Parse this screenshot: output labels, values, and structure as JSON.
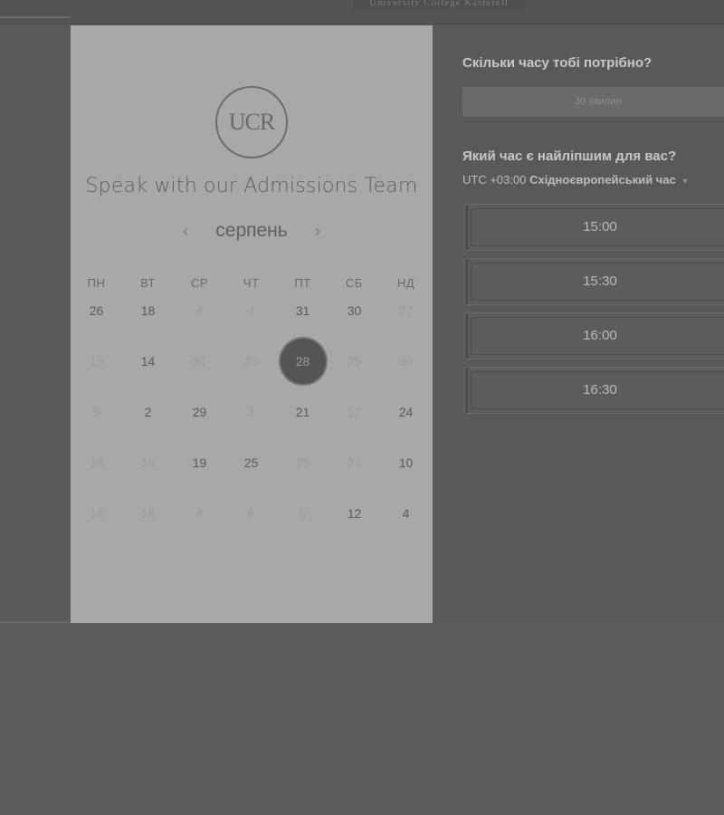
{
  "header": {
    "brand": "University College Kasterell"
  },
  "calendar": {
    "logo_text": "UCR",
    "title": "Speak with our Admissions Team",
    "month": "серпень",
    "prev_icon": "chevron-left-icon",
    "next_icon": "chevron-right-icon",
    "weekdays": [
      "ПН",
      "ВТ",
      "СР",
      "ЧТ",
      "ПТ",
      "СБ",
      "НД"
    ],
    "weeks": [
      [
        {
          "d": "26",
          "s": "active"
        },
        {
          "d": "18",
          "s": "active"
        },
        {
          "d": "4",
          "s": "inactive"
        },
        {
          "d": "4",
          "s": "inactive"
        },
        {
          "d": "31",
          "s": "active"
        },
        {
          "d": "30",
          "s": "active"
        },
        {
          "d": "27",
          "s": "inactive"
        }
      ],
      [
        {
          "d": "19",
          "s": "inactive"
        },
        {
          "d": "14",
          "s": "active"
        },
        {
          "d": "31",
          "s": "inactive"
        },
        {
          "d": "23",
          "s": "inactive"
        },
        {
          "d": "28",
          "s": "selected"
        },
        {
          "d": "29",
          "s": "inactive"
        },
        {
          "d": "30",
          "s": "inactive"
        }
      ],
      [
        {
          "d": "5",
          "s": "inactive"
        },
        {
          "d": "2",
          "s": "active"
        },
        {
          "d": "29",
          "s": "active"
        },
        {
          "d": "3",
          "s": "inactive"
        },
        {
          "d": "21",
          "s": "active"
        },
        {
          "d": "17",
          "s": "inactive"
        },
        {
          "d": "24",
          "s": "active"
        }
      ],
      [
        {
          "d": "18",
          "s": "inactive"
        },
        {
          "d": "19",
          "s": "inactive"
        },
        {
          "d": "19",
          "s": "active"
        },
        {
          "d": "25",
          "s": "active"
        },
        {
          "d": "25",
          "s": "inactive"
        },
        {
          "d": "21",
          "s": "inactive"
        },
        {
          "d": "10",
          "s": "active"
        }
      ],
      [
        {
          "d": "14",
          "s": "inactive"
        },
        {
          "d": "18",
          "s": "inactive"
        },
        {
          "d": "4",
          "s": "inactive"
        },
        {
          "d": "6",
          "s": "inactive"
        },
        {
          "d": "5",
          "s": "inactive"
        },
        {
          "d": "12",
          "s": "active"
        },
        {
          "d": "4",
          "s": "active"
        }
      ]
    ]
  },
  "booking": {
    "duration_question": "Скільки часу тобі потрібно?",
    "duration_value": "30 хвилин",
    "time_question": "Який час є найліпшим для вас?",
    "timezone_offset": "UTC +03:00",
    "timezone_name": "Східноєвропейський час",
    "timezone_caret": "▾",
    "slots": [
      "15:00",
      "15:30",
      "16:00",
      "16:30"
    ]
  }
}
